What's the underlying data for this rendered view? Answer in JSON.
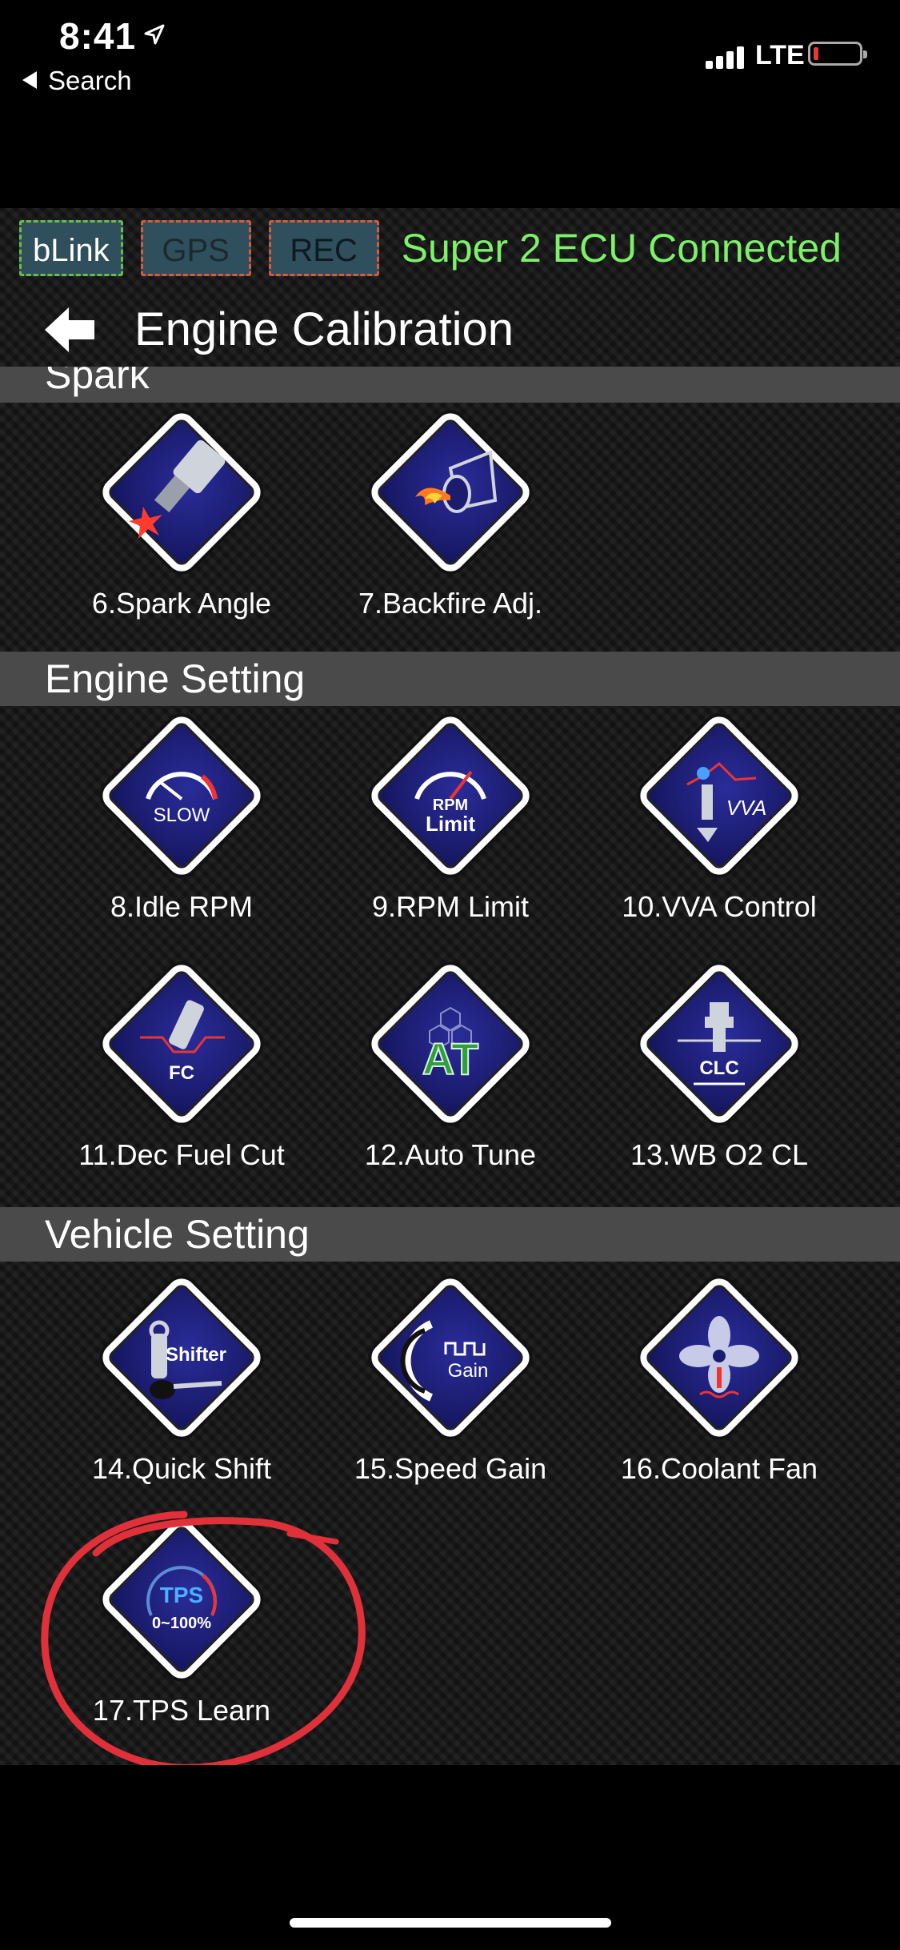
{
  "status": {
    "time": "8:41",
    "back_app": "Search",
    "network": "LTE"
  },
  "chips": {
    "blink": "bLink",
    "gps": "GPS",
    "rec": "REC"
  },
  "connection_status": "Super 2 ECU Connected",
  "page_title": "Engine Calibration",
  "sections": {
    "spark": {
      "title": "Spark",
      "tiles": [
        {
          "label": "6.Spark Angle"
        },
        {
          "label": "7.Backfire Adj."
        }
      ]
    },
    "engine": {
      "title": "Engine Setting",
      "tiles": [
        {
          "label": "8.Idle RPM",
          "icon_text": "SLOW"
        },
        {
          "label": "9.RPM Limit",
          "icon_text": "RPM",
          "icon_text2": "Limit"
        },
        {
          "label": "10.VVA Control",
          "icon_text": "VVA"
        },
        {
          "label": "11.Dec Fuel Cut",
          "icon_text": "FC"
        },
        {
          "label": "12.Auto Tune",
          "icon_text": "AT"
        },
        {
          "label": "13.WB O2 CL",
          "icon_text": "CLC"
        }
      ]
    },
    "vehicle": {
      "title": "Vehicle Setting",
      "tiles": [
        {
          "label": "14.Quick Shift",
          "icon_text": "Shifter"
        },
        {
          "label": "15.Speed Gain",
          "icon_text": "Gain"
        },
        {
          "label": "16.Coolant Fan"
        },
        {
          "label": "17.TPS Learn",
          "icon_text": "TPS",
          "icon_text2": "0~100%"
        }
      ]
    }
  },
  "colors": {
    "connected_green": "#7ef06a",
    "highlight_red": "#e0303a",
    "section_gray": "#4a4a4a",
    "icon_blue": "#1b1c6e"
  }
}
